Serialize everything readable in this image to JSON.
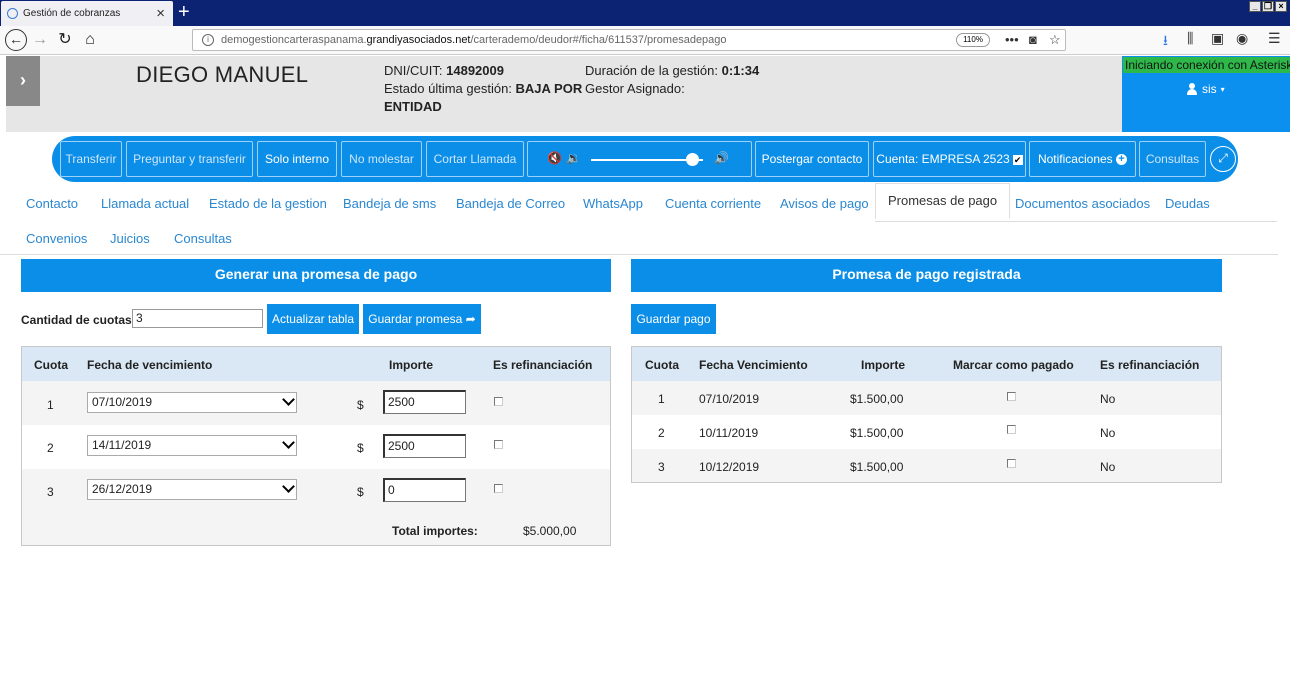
{
  "browser": {
    "tab_title": "Gestión de cobranzas",
    "url_prefix": "demogestioncarteraspanama.",
    "url_host": "grandiyasociados.net",
    "url_path": "/carterademo/deudor#/ficha/611537/promesadepago",
    "zoom": "110%"
  },
  "header": {
    "client_name": "DIEGO MANUEL",
    "dni_label": "DNI/CUIT:",
    "dni_value": "14892009",
    "estado_label": "Estado última gestión:",
    "estado_value": "BAJA POR ENTIDAD",
    "duracion_label": "Duración de la gestión:",
    "duracion_value": "0:1:34",
    "gestor_label": "Gestor Asignado:",
    "asterisk_status": "Iniciando conexión con Asterisk",
    "user": "sis"
  },
  "toolbar": {
    "transferir": "Transferir",
    "preguntar": "Preguntar y transferir",
    "solo_interno": "Solo interno",
    "no_molestar": "No molestar",
    "cortar": "Cortar Llamada",
    "volume_level": 0.9,
    "postergar": "Postergar contacto",
    "cuenta": "Cuenta: EMPRESA 2523",
    "notificaciones": "Notificaciones",
    "consultas": "Consultas"
  },
  "tabs": [
    "Contacto",
    "Llamada actual",
    "Estado de la gestion",
    "Bandeja de sms",
    "Bandeja de Correo",
    "WhatsApp",
    "Cuenta corriente",
    "Avisos de pago",
    "Promesas de pago",
    "Documentos asociados",
    "Deudas",
    "Convenios",
    "Juicios",
    "Consultas"
  ],
  "left_panel": {
    "title": "Generar una promesa de pago",
    "cuotas_label": "Cantidad de cuotas",
    "cuotas_value": "3",
    "actualizar": "Actualizar tabla",
    "guardar": "Guardar promesa",
    "headers": [
      "Cuota",
      "Fecha de vencimiento",
      "Importe",
      "Es refinanciación"
    ],
    "currency": "$",
    "rows": [
      {
        "cuota": "1",
        "fecha": "07/10/2019",
        "importe": "2500"
      },
      {
        "cuota": "2",
        "fecha": "14/11/2019",
        "importe": "2500"
      },
      {
        "cuota": "3",
        "fecha": "26/12/2019",
        "importe": "0"
      }
    ],
    "total_label": "Total importes:",
    "total_value": "$5.000,00"
  },
  "right_panel": {
    "title": "Promesa de pago registrada",
    "guardar_pago": "Guardar pago",
    "headers": [
      "Cuota",
      "Fecha Vencimiento",
      "Importe",
      "Marcar como pagado",
      "Es refinanciación"
    ],
    "rows": [
      {
        "cuota": "1",
        "fecha": "07/10/2019",
        "importe": "$1.500,00",
        "refin": "No"
      },
      {
        "cuota": "2",
        "fecha": "10/11/2019",
        "importe": "$1.500,00",
        "refin": "No"
      },
      {
        "cuota": "3",
        "fecha": "10/12/2019",
        "importe": "$1.500,00",
        "refin": "No"
      }
    ]
  }
}
